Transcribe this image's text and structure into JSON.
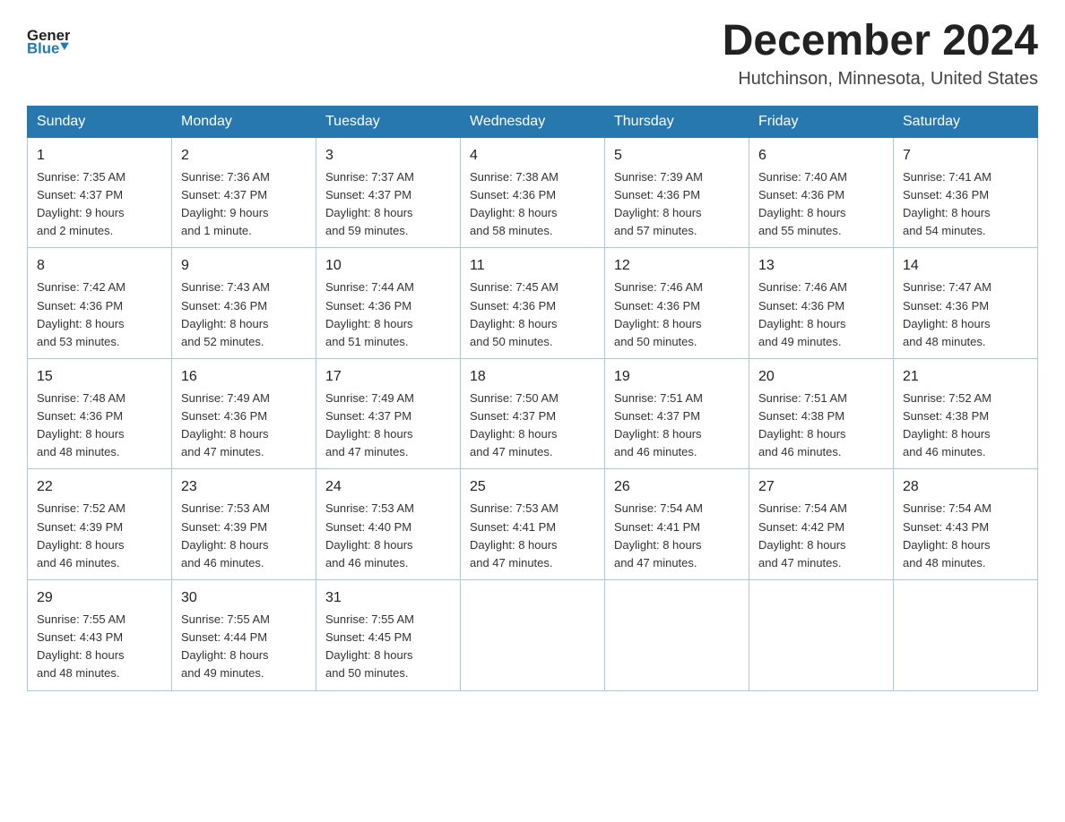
{
  "logo": {
    "text_general": "General",
    "text_blue": "Blue",
    "arrow_color": "#1a7abf"
  },
  "title": "December 2024",
  "location": "Hutchinson, Minnesota, United States",
  "days_of_week": [
    "Sunday",
    "Monday",
    "Tuesday",
    "Wednesday",
    "Thursday",
    "Friday",
    "Saturday"
  ],
  "weeks": [
    [
      {
        "day": "1",
        "sunrise": "7:35 AM",
        "sunset": "4:37 PM",
        "daylight": "9 hours and 2 minutes."
      },
      {
        "day": "2",
        "sunrise": "7:36 AM",
        "sunset": "4:37 PM",
        "daylight": "9 hours and 1 minute."
      },
      {
        "day": "3",
        "sunrise": "7:37 AM",
        "sunset": "4:37 PM",
        "daylight": "8 hours and 59 minutes."
      },
      {
        "day": "4",
        "sunrise": "7:38 AM",
        "sunset": "4:36 PM",
        "daylight": "8 hours and 58 minutes."
      },
      {
        "day": "5",
        "sunrise": "7:39 AM",
        "sunset": "4:36 PM",
        "daylight": "8 hours and 57 minutes."
      },
      {
        "day": "6",
        "sunrise": "7:40 AM",
        "sunset": "4:36 PM",
        "daylight": "8 hours and 55 minutes."
      },
      {
        "day": "7",
        "sunrise": "7:41 AM",
        "sunset": "4:36 PM",
        "daylight": "8 hours and 54 minutes."
      }
    ],
    [
      {
        "day": "8",
        "sunrise": "7:42 AM",
        "sunset": "4:36 PM",
        "daylight": "8 hours and 53 minutes."
      },
      {
        "day": "9",
        "sunrise": "7:43 AM",
        "sunset": "4:36 PM",
        "daylight": "8 hours and 52 minutes."
      },
      {
        "day": "10",
        "sunrise": "7:44 AM",
        "sunset": "4:36 PM",
        "daylight": "8 hours and 51 minutes."
      },
      {
        "day": "11",
        "sunrise": "7:45 AM",
        "sunset": "4:36 PM",
        "daylight": "8 hours and 50 minutes."
      },
      {
        "day": "12",
        "sunrise": "7:46 AM",
        "sunset": "4:36 PM",
        "daylight": "8 hours and 50 minutes."
      },
      {
        "day": "13",
        "sunrise": "7:46 AM",
        "sunset": "4:36 PM",
        "daylight": "8 hours and 49 minutes."
      },
      {
        "day": "14",
        "sunrise": "7:47 AM",
        "sunset": "4:36 PM",
        "daylight": "8 hours and 48 minutes."
      }
    ],
    [
      {
        "day": "15",
        "sunrise": "7:48 AM",
        "sunset": "4:36 PM",
        "daylight": "8 hours and 48 minutes."
      },
      {
        "day": "16",
        "sunrise": "7:49 AM",
        "sunset": "4:36 PM",
        "daylight": "8 hours and 47 minutes."
      },
      {
        "day": "17",
        "sunrise": "7:49 AM",
        "sunset": "4:37 PM",
        "daylight": "8 hours and 47 minutes."
      },
      {
        "day": "18",
        "sunrise": "7:50 AM",
        "sunset": "4:37 PM",
        "daylight": "8 hours and 47 minutes."
      },
      {
        "day": "19",
        "sunrise": "7:51 AM",
        "sunset": "4:37 PM",
        "daylight": "8 hours and 46 minutes."
      },
      {
        "day": "20",
        "sunrise": "7:51 AM",
        "sunset": "4:38 PM",
        "daylight": "8 hours and 46 minutes."
      },
      {
        "day": "21",
        "sunrise": "7:52 AM",
        "sunset": "4:38 PM",
        "daylight": "8 hours and 46 minutes."
      }
    ],
    [
      {
        "day": "22",
        "sunrise": "7:52 AM",
        "sunset": "4:39 PM",
        "daylight": "8 hours and 46 minutes."
      },
      {
        "day": "23",
        "sunrise": "7:53 AM",
        "sunset": "4:39 PM",
        "daylight": "8 hours and 46 minutes."
      },
      {
        "day": "24",
        "sunrise": "7:53 AM",
        "sunset": "4:40 PM",
        "daylight": "8 hours and 46 minutes."
      },
      {
        "day": "25",
        "sunrise": "7:53 AM",
        "sunset": "4:41 PM",
        "daylight": "8 hours and 47 minutes."
      },
      {
        "day": "26",
        "sunrise": "7:54 AM",
        "sunset": "4:41 PM",
        "daylight": "8 hours and 47 minutes."
      },
      {
        "day": "27",
        "sunrise": "7:54 AM",
        "sunset": "4:42 PM",
        "daylight": "8 hours and 47 minutes."
      },
      {
        "day": "28",
        "sunrise": "7:54 AM",
        "sunset": "4:43 PM",
        "daylight": "8 hours and 48 minutes."
      }
    ],
    [
      {
        "day": "29",
        "sunrise": "7:55 AM",
        "sunset": "4:43 PM",
        "daylight": "8 hours and 48 minutes."
      },
      {
        "day": "30",
        "sunrise": "7:55 AM",
        "sunset": "4:44 PM",
        "daylight": "8 hours and 49 minutes."
      },
      {
        "day": "31",
        "sunrise": "7:55 AM",
        "sunset": "4:45 PM",
        "daylight": "8 hours and 50 minutes."
      },
      null,
      null,
      null,
      null
    ]
  ],
  "labels": {
    "sunrise": "Sunrise:",
    "sunset": "Sunset:",
    "daylight": "Daylight:"
  }
}
